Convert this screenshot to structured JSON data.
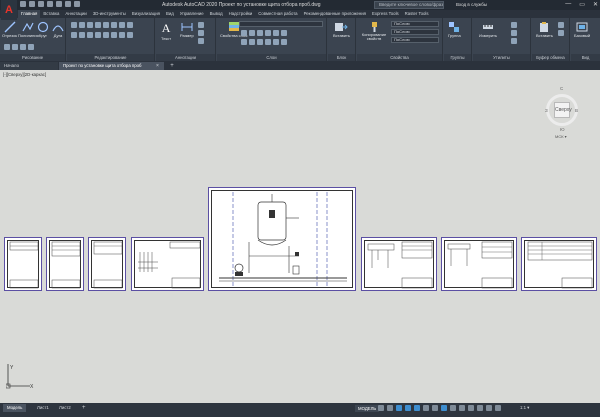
{
  "app": {
    "title": "Autodesk AutoCAD 2020   Проект по установке щита отбора проб.dwg",
    "search_placeholder": "Введите ключевое слово/фразу",
    "signin": "Вход в службы",
    "window_controls": [
      "—",
      "▭",
      "✕"
    ]
  },
  "ribbon_tabs": [
    {
      "label": "Главная",
      "active": true
    },
    {
      "label": "Вставка"
    },
    {
      "label": "Аннотации"
    },
    {
      "label": "3D-инструменты"
    },
    {
      "label": "Визуализация"
    },
    {
      "label": "Вид"
    },
    {
      "label": "Управление"
    },
    {
      "label": "Вывод"
    },
    {
      "label": "Надстройки"
    },
    {
      "label": "Совместная работа"
    },
    {
      "label": "Рекомендованные приложения"
    },
    {
      "label": "Express Tools"
    },
    {
      "label": "Raster Tools"
    }
  ],
  "ribbon": {
    "draw": {
      "title": "Рисование",
      "tools": [
        "Отрезок",
        "Полилиния",
        "Круг",
        "Дуга"
      ]
    },
    "modify": {
      "title": "Редактирование"
    },
    "annotation": {
      "title": "Аннотации",
      "tools": [
        "Текст",
        "Размер"
      ]
    },
    "layers": {
      "title": "Слои",
      "tools": [
        "Свойства слоя"
      ]
    },
    "block": {
      "title": "Блок",
      "tools": [
        "Вставить"
      ]
    },
    "properties": {
      "title": "Свойства",
      "tools": [
        "Копирование свойств"
      ],
      "dropdowns": [
        "ПоСлою",
        "ПоСлою",
        "ПоСлою"
      ]
    },
    "groups": {
      "title": "Группы",
      "tools": [
        "Группа"
      ]
    },
    "utilities": {
      "title": "Утилиты",
      "tools": [
        "Измерить"
      ]
    },
    "clipboard": {
      "title": "Буфер обмена",
      "tools": [
        "Вставить"
      ]
    },
    "view": {
      "title": "Вид",
      "tools": [
        "Базовый"
      ]
    }
  },
  "doc_tabs": {
    "start": "Начало",
    "drawing": "Проект по установке щита отбора проб",
    "close": "×",
    "add": "+"
  },
  "viewport": {
    "label": "[-][Сверху][2D-каркас]",
    "viewcube": {
      "face": "Сверху",
      "north": "С",
      "south": "Ю",
      "west": "З",
      "east": "В",
      "wcs": "МСК ▾"
    },
    "ucs": {
      "x": "X",
      "y": "Y"
    }
  },
  "status": {
    "layout_tabs": [
      "Модель",
      "Лист1",
      "Лист2"
    ],
    "add": "+",
    "model": "МОДЕЛЬ",
    "scale": "1:1 ▾"
  },
  "colors": {
    "titlebar": "#232a33",
    "ribbon": "#3b4450",
    "canvas": "#d9dad7",
    "sheet_border": "#5b4fa3",
    "accent": "#3e8ed0",
    "logo": "#e6352b"
  }
}
